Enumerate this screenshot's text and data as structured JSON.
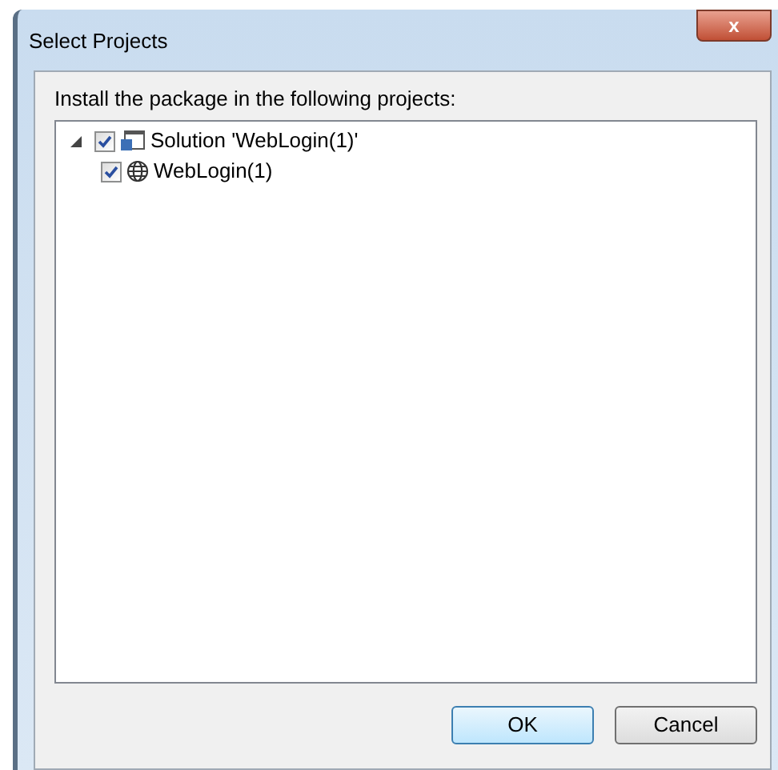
{
  "window": {
    "title": "Select Projects",
    "close": "x"
  },
  "instruction": "Install the package in the following projects:",
  "tree": [
    {
      "label": "Solution 'WebLogin(1)'",
      "kind": "solution",
      "expanded": true,
      "checked": true,
      "children": [
        {
          "label": "WebLogin(1)",
          "kind": "web",
          "checked": true
        }
      ]
    }
  ],
  "buttons": [
    {
      "label": "OK",
      "default": true
    },
    {
      "label": "Cancel",
      "default": false
    }
  ]
}
